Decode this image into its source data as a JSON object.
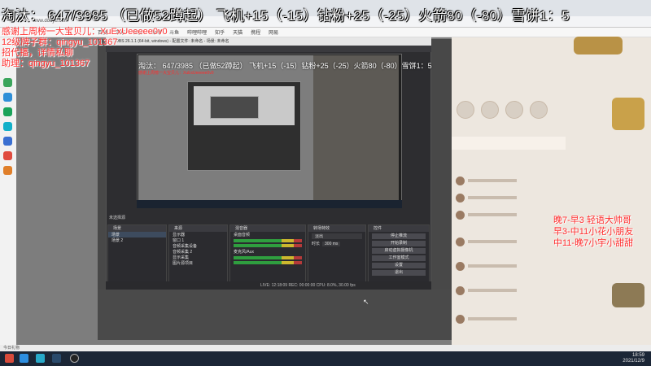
{
  "overlay": {
    "main_banner": "淘汰： 647/3985 （已做52蹲起） 飞机+15（-15）钻粉+25（-25）火箭80（-80）雪饼1：5",
    "thanks": "感谢上周榜一大宝贝儿：XuExUeeeee0v0",
    "fans_group": "12级牌子群：qingyu_101367",
    "recruit": "招代播，详情私聊",
    "assistant": "助理：qingyu_101367",
    "schedule": [
      "晚7-早3 轻语大帅哥",
      "早3-中11小花小朋友",
      "中11-晚7小宇小甜甜"
    ]
  },
  "obs": {
    "title": "OBS 26.1.1 (64-bit, windows) - 配置文件: 未命名 - 场景: 未命名",
    "scene_label": "未选择源",
    "scenes_header": "场景",
    "scenes": [
      "场景",
      "场景 2"
    ],
    "sources_header": "来源",
    "sources": [
      "显示器",
      "窗口 1",
      "音频采集设备",
      "音频采集 2",
      "显示采集",
      "图片源项目"
    ],
    "mixer_header": "混音器",
    "mixer_tracks": [
      "桌面音频",
      "麦克风/Aux"
    ],
    "transitions_header": "转场特效",
    "transition_value": "淡出",
    "duration_label": "时长",
    "duration_value": "300 ms",
    "controls_header": "控件",
    "controls": [
      "停止推流",
      "开始录制",
      "启动虚拟摄像机",
      "工作室模式",
      "设置",
      "退出"
    ],
    "status": "LIVE: 12:18:09   REC: 00:00:00   CPU: 8.0%, 30.00 fps"
  },
  "mini_overlay": {
    "banner": "淘汰： 647/3985 （已做52蹲起） 飞机+15（-15）钻粉+25（-25）火箭80（-80）雪饼1：5",
    "thanks": "感谢上周榜一大宝贝儿：XuExUeeeee0v0"
  },
  "browser": {
    "url": "www.douyu.com",
    "bookmarks": [
      "百度",
      "京东",
      "淘宝",
      "微博",
      "斗鱼",
      "哔哩哔哩",
      "知乎",
      "天猫",
      "携程",
      "网易"
    ]
  },
  "page_status": "今日礼物",
  "clock": {
    "time": "18:59",
    "date": "2021/12/9"
  },
  "colors": {
    "overlay_red": "#ff2d2d",
    "taskbar": "#1b2636",
    "obs_dark": "#2d2d30"
  }
}
